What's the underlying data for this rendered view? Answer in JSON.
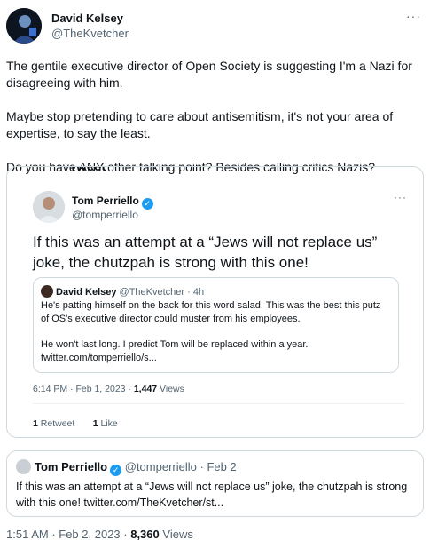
{
  "tweet": {
    "author_name": "David Kelsey",
    "author_handle": "@TheKvetcher",
    "more_icon": "more-horizontal-icon",
    "paragraphs": [
      "The gentile executive director of Open Society is suggesting I'm a Nazi for disagreeing with him.",
      "Maybe stop pretending to care about antisemitism, it's not your area of expertise, to say the least.",
      "Do you have ANY other talking point? Besides calling critics Nazis?"
    ],
    "time": "1:51 AM",
    "date": "Feb 2, 2023",
    "views_count": "8,360",
    "views_label": "Views"
  },
  "screenshot": {
    "cutoff_text": "Tweet",
    "author_name": "Tom Perriello",
    "author_handle": "@tomperriello",
    "text": "If this was an attempt at a “Jews will not replace us” joke, the chutzpah is strong with this one!",
    "quote": {
      "author_name": "David Kelsey",
      "author_handle": "@TheKvetcher",
      "age": "4h",
      "paragraphs": [
        "He's patting himself on the back for this word salad. This was the best this putz of OS's executive director could muster from his employees.",
        "He won't last long. I predict Tom will be replaced within a year. twitter.com/tomperriello/s..."
      ]
    },
    "time": "6:14 PM",
    "date": "Feb 1, 2023",
    "views_count": "1,447",
    "views_label": "Views",
    "retweets_count": "1",
    "retweets_label": "Retweet",
    "likes_count": "1",
    "likes_label": "Like"
  },
  "quoted_tweet": {
    "author_name": "Tom Perriello",
    "author_handle": "@tomperriello",
    "date": "Feb 2",
    "text": "If this was an attempt at a “Jews will not replace us” joke, the chutzpah is strong with this one! twitter.com/TheKvetcher/st..."
  },
  "colors": {
    "accent": "#1d9bf0",
    "secondary_text": "#536471",
    "border": "#cfd9de"
  }
}
